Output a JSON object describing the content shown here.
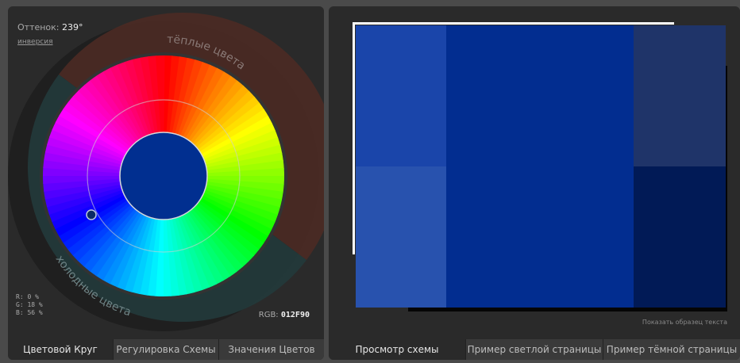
{
  "left_panel": {
    "hue_label": "Оттенок:",
    "hue_value": "239°",
    "invert_link": "инверсия",
    "warm_label": "тёплые цвета",
    "cold_label": "холодные цвета",
    "rgb_r": "R:  0 %",
    "rgb_g": "G: 18 %",
    "rgb_b": "B: 56 %",
    "rgb_label": "RGB:",
    "rgb_hex": "012F90",
    "selected_color": "#012F90",
    "tabs": [
      "Цветовой Круг",
      "Регулировка Схемы",
      "Значения Цветов"
    ]
  },
  "right_panel": {
    "sample_text_link": "Показать образец текста",
    "tabs": [
      "Просмотр схемы",
      "Пример светлой страницы",
      "Пример тёмной страницы"
    ],
    "swatches": {
      "main": "#022d90",
      "left_top": "#1a45aa",
      "left_bottom": "#2852ae",
      "right_top": "#1f3469",
      "right_bottom": "#011a56"
    }
  }
}
